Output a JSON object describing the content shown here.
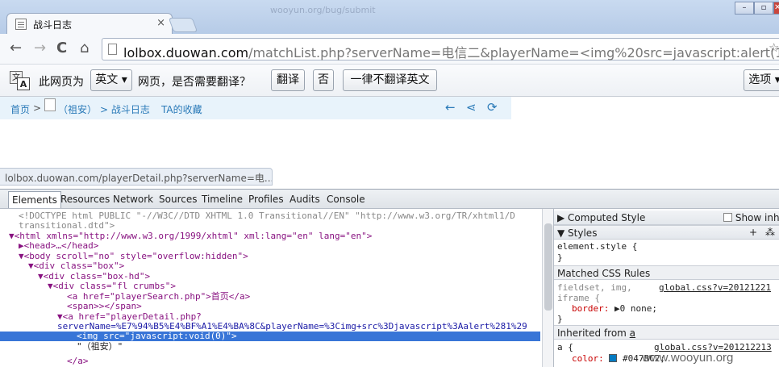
{
  "browser": {
    "tab_title": "战斗日志",
    "tab_close": "×",
    "tabstrip_ghost": "wooyun.org/bug/submit",
    "window_buttons": [
      "–",
      "▫",
      "✕"
    ],
    "nav": {
      "back": "←",
      "forward": "→",
      "reload": "C",
      "home": "⌂"
    },
    "url_host": "lolbox.duowan.com",
    "url_rest": "/matchList.php?serverName=电信二&playerName=<img%20src=javascript:alert(1);/>",
    "star": "☆"
  },
  "translate_bar": {
    "prefix": "此网页为",
    "language": "英文 ▾",
    "question": "网页，是否需要翻译？",
    "translate_btn": "翻译",
    "no_btn": "否",
    "never_btn": "一律不翻译英文",
    "options_btn": "选项 ▾"
  },
  "page": {
    "crumb_home": "首页",
    "crumb_sep1": ">",
    "crumb_player": "（祖安）",
    "crumb_sep2": "> 战斗日志",
    "crumb_fav": "TA的收藏",
    "icon_back": "←",
    "icon_share": "⋖",
    "icon_refresh": "⟳"
  },
  "status_url": "lolbox.duowan.com/playerDetail.php?serverName=电...",
  "devtools": {
    "tabs": [
      "Elements",
      "Resources",
      "Network",
      "Sources",
      "Timeline",
      "Profiles",
      "Audits",
      "Console"
    ],
    "selected_tab": "Elements",
    "dom_lines": [
      "<!DOCTYPE html PUBLIC \"-//W3C//DTD XHTML 1.0 Transitional//EN\" \"http://www.w3.org/TR/xhtml1/D",
      "transitional.dtd\">",
      "▼<html xmlns=\"http://www.w3.org/1999/xhtml\" xml:lang=\"en\" lang=\"en\">",
      "▶<head>…</head>",
      "▼<body scroll=\"no\" style=\"overflow:hidden\">",
      "▼<div class=\"box\">",
      "▼<div class=\"box-hd\">",
      "▼<div class=\"fl crumbs\">",
      "<a href=\"playerSearch.php\">首页</a>",
      "<span>></span>",
      "▼<a href=\"playerDetail.php?",
      "serverName=%E7%94%B5%E4%BF%A1%E4%BA%8C&playerName=%3Cimg+src%3Djavascript%3Aalert%281%29",
      "<img src=\"javascript:void(0)\">",
      "\"（祖安）\"",
      "</a>"
    ],
    "sidebar": {
      "computed_style": "Computed Style",
      "show_inherited": "Show inhe",
      "styles": "Styles",
      "element_style": "element.style {",
      "close_brace": "}",
      "matched_rules": "Matched CSS Rules",
      "rule1_selector": "fieldset, img,",
      "rule1_selector2": "iframe {",
      "rule1_source": "global.css?v=20121221",
      "rule1_prop": "border:",
      "rule1_value": "▶0 none;",
      "inherited_from": "Inherited from ",
      "inherited_tag": "a",
      "rule2_selector": "a {",
      "rule2_source": "global.css?v=201212213",
      "rule2_prop": "color:",
      "rule2_value": "#047BC2;"
    }
  },
  "watermark": "www.wooyun.org",
  "colors": {
    "link_color": "#047BC2",
    "selection": "#3875d7",
    "crumb_bg": "#e8f3fb"
  }
}
